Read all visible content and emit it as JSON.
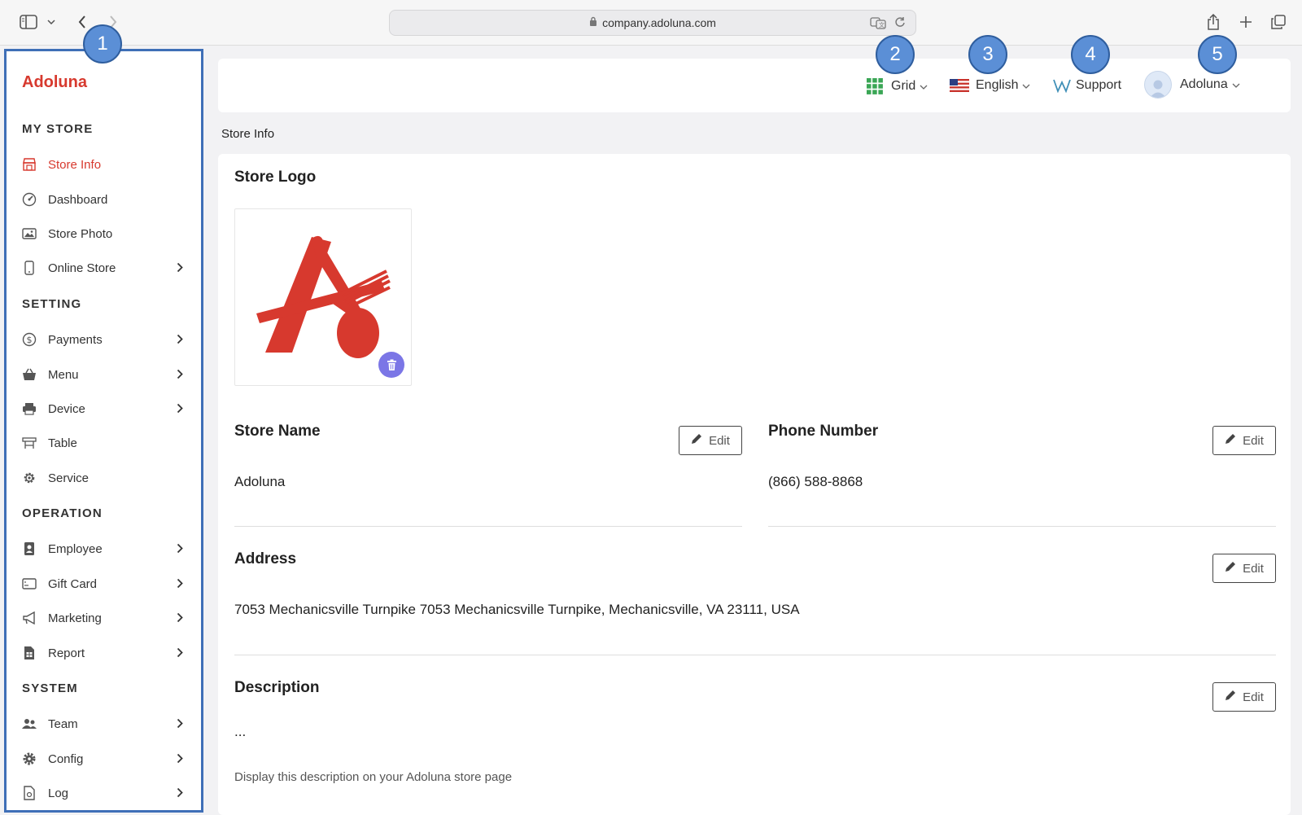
{
  "browser": {
    "url": "company.adoluna.com"
  },
  "sidebar": {
    "brand": "Adoluna",
    "sections": {
      "my_store": "MY STORE",
      "setting": "SETTING",
      "operation": "OPERATION",
      "system": "SYSTEM"
    },
    "items": [
      {
        "label": "Store Info",
        "icon": "store-icon",
        "active": true
      },
      {
        "label": "Dashboard",
        "icon": "dashboard-icon"
      },
      {
        "label": "Store Photo",
        "icon": "photo-icon"
      },
      {
        "label": "Online Store",
        "icon": "phone-icon",
        "chevron": true
      },
      {
        "label": "Payments",
        "icon": "dollar-icon",
        "chevron": true
      },
      {
        "label": "Menu",
        "icon": "basket-icon",
        "chevron": true
      },
      {
        "label": "Device",
        "icon": "printer-icon",
        "chevron": true
      },
      {
        "label": "Table",
        "icon": "table-icon"
      },
      {
        "label": "Service",
        "icon": "gear-icon"
      },
      {
        "label": "Employee",
        "icon": "badge-icon",
        "chevron": true
      },
      {
        "label": "Gift Card",
        "icon": "gift-card-icon",
        "chevron": true
      },
      {
        "label": "Marketing",
        "icon": "megaphone-icon",
        "chevron": true
      },
      {
        "label": "Report",
        "icon": "report-icon",
        "chevron": true
      },
      {
        "label": "Team",
        "icon": "team-icon",
        "chevron": true
      },
      {
        "label": "Config",
        "icon": "cog-icon",
        "chevron": true
      },
      {
        "label": "Log",
        "icon": "log-icon",
        "chevron": true
      }
    ]
  },
  "header": {
    "grid_label": "Grid",
    "language_label": "English",
    "support_label": "Support",
    "user_label": "Adoluna"
  },
  "breadcrumb": "Store Info",
  "main": {
    "logo_title": "Store Logo",
    "store_name_title": "Store Name",
    "store_name_value": "Adoluna",
    "phone_title": "Phone Number",
    "phone_value": "(866) 588-8868",
    "address_title": "Address",
    "address_value": "7053 Mechanicsville Turnpike 7053 Mechanicsville Turnpike, Mechanicsville, VA 23111, USA",
    "description_title": "Description",
    "description_value": "...",
    "description_hint": "Display this description on your Adoluna store page",
    "edit_label": "Edit"
  },
  "callouts": [
    "1",
    "2",
    "3",
    "4",
    "5"
  ],
  "colors": {
    "brand": "#d7392e",
    "callout": "#5b8fd6",
    "sidebar_border": "#3f6fb7",
    "trash": "#7b76e6"
  }
}
